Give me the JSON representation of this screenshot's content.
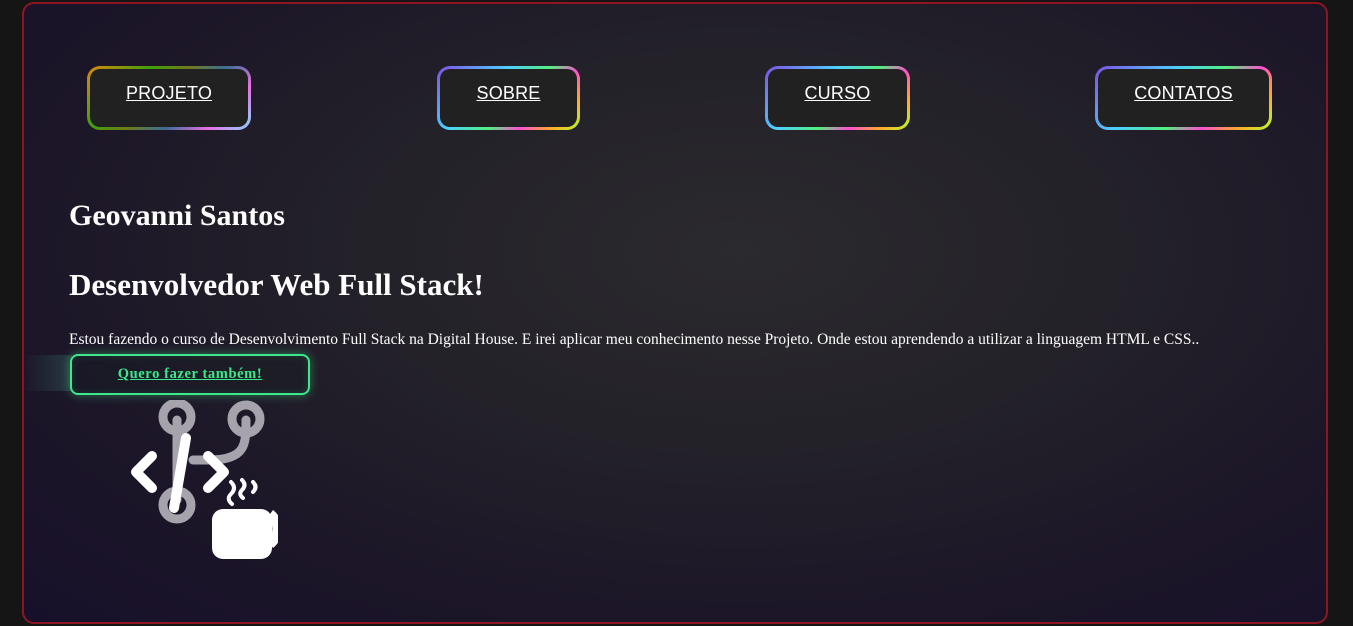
{
  "nav": {
    "items": [
      {
        "label": "PROJETO"
      },
      {
        "label": "SOBRE"
      },
      {
        "label": "CURSO"
      },
      {
        "label": "CONTATOS"
      }
    ]
  },
  "hero": {
    "name": "Geovanni Santos",
    "role": "Desenvolvedor Web Full Stack!",
    "description": "Estou fazendo o curso de Desenvolvimento Full Stack na Digital House. E irei aplicar meu conhecimento nesse Projeto. Onde estou aprendendo a utilizar a linguagem HTML e CSS..",
    "cta_label": "Quero fazer também!"
  },
  "illustration": {
    "icon": "code-git-coffee-icon"
  },
  "colors": {
    "frame_border": "#8e1522",
    "cta_accent": "#3de88c",
    "nav_inner": "#212121"
  }
}
